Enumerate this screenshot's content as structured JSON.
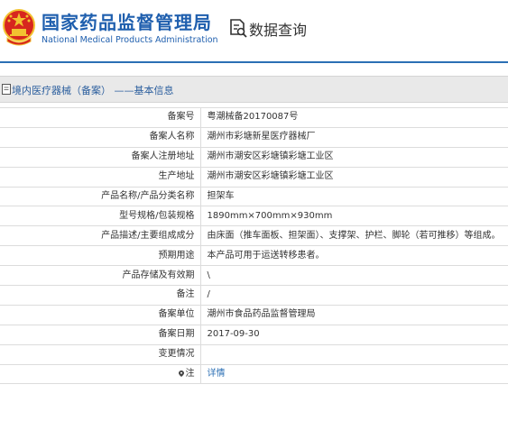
{
  "header": {
    "agency_name_cn": "国家药品监督管理局",
    "agency_name_en": "National Medical Products Administration",
    "query_title": "数据查询"
  },
  "section": {
    "title": "境内医疗器械（备案） ——基本信息"
  },
  "colors": {
    "brand_blue": "#1f5fae",
    "link_blue": "#2b6fb4",
    "emblem_red": "#d7261e",
    "emblem_gold": "#f2c230"
  },
  "icons": [
    "national-emblem-icon",
    "search-document-icon",
    "document-icon",
    "location-pin-icon"
  ],
  "rows": [
    {
      "label": "备案号",
      "value": "粤潮械备20170087号"
    },
    {
      "label": "备案人名称",
      "value": "潮州市彩塘新星医疗器械厂"
    },
    {
      "label": "备案人注册地址",
      "value": "潮州市潮安区彩塘镇彩塘工业区"
    },
    {
      "label": "生产地址",
      "value": "潮州市潮安区彩塘镇彩塘工业区"
    },
    {
      "label": "产品名称/产品分类名称",
      "value": "担架车"
    },
    {
      "label": "型号规格/包装规格",
      "value": "1890mm×700mm×930mm"
    },
    {
      "label": "产品描述/主要组成成分",
      "value": "由床面（推车面板、担架面）、支撑架、护栏、脚轮（若可推移）等组成。"
    },
    {
      "label": "预期用途",
      "value": "本产品可用于运送转移患者。"
    },
    {
      "label": "产品存储及有效期",
      "value": "\\"
    },
    {
      "label": "备注",
      "value": "/"
    },
    {
      "label": "备案单位",
      "value": "潮州市食品药品监督管理局"
    },
    {
      "label": "备案日期",
      "value": "2017-09-30"
    },
    {
      "label": "变更情况",
      "value": ""
    },
    {
      "label": "注",
      "value": "详情"
    }
  ]
}
